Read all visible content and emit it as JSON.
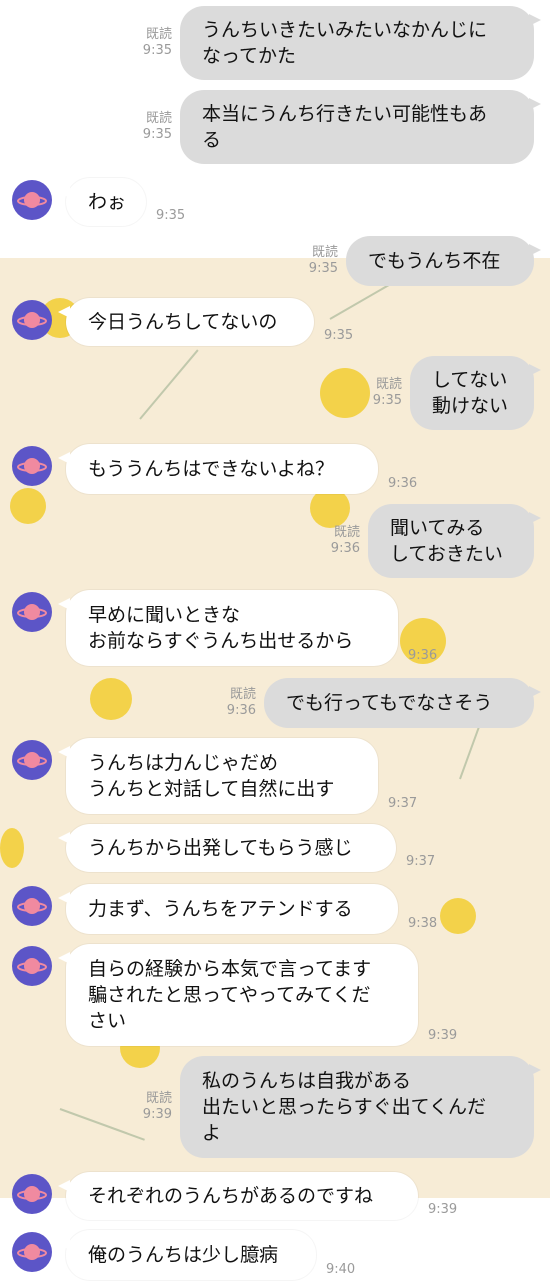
{
  "read_label": "既読",
  "messages": [
    {
      "side": "out",
      "lines": [
        "うんちいきたいみたいなかんじに",
        "なってかた"
      ],
      "read": "既読",
      "time": "9:35"
    },
    {
      "side": "out",
      "lines": [
        "本当にうんち行きたい可能性もあ",
        "る"
      ],
      "read": "既読",
      "time": "9:35"
    },
    {
      "side": "in",
      "lines": [
        "わぉ"
      ],
      "time": "9:35"
    },
    {
      "side": "out",
      "lines": [
        "でもうんち不在"
      ],
      "read": "既読",
      "time": "9:35"
    },
    {
      "side": "in",
      "lines": [
        "今日うんちしてないの"
      ],
      "time": "9:35"
    },
    {
      "side": "out",
      "lines": [
        "してない",
        "動けない"
      ],
      "read": "既読",
      "time": "9:35"
    },
    {
      "side": "in",
      "lines": [
        "もううんちはできないよね？"
      ],
      "time": "9:36"
    },
    {
      "side": "out",
      "lines": [
        "聞いてみる",
        "しておきたい"
      ],
      "read": "既読",
      "time": "9:36"
    },
    {
      "side": "in",
      "lines": [
        "早めに聞いときな",
        "お前ならすぐうんち出せるから"
      ],
      "time": "9:36"
    },
    {
      "side": "out",
      "lines": [
        "でも行ってもでなさそう"
      ],
      "read": "既読",
      "time": "9:36"
    },
    {
      "side": "in",
      "lines": [
        "うんちは力んじゃだめ",
        "うんちと対話して自然に出す"
      ],
      "time": "9:37"
    },
    {
      "side": "in",
      "lines": [
        "うんちから出発してもらう感じ"
      ],
      "time": "9:37"
    },
    {
      "side": "in",
      "lines": [
        "力まず、うんちをアテンドする"
      ],
      "time": "9:38"
    },
    {
      "side": "in",
      "lines": [
        "自らの経験から本気で言ってます",
        "騙されたと思ってやってみてくだ",
        "さい"
      ],
      "time": "9:39"
    },
    {
      "side": "out",
      "lines": [
        "私のうんちは自我がある",
        "出たいと思ったらすぐ出てくんだ",
        "よ"
      ],
      "read": "既読",
      "time": "9:39"
    },
    {
      "side": "in",
      "lines": [
        "それぞれのうんちがあるのですね"
      ],
      "time": "9:39"
    },
    {
      "side": "in",
      "lines": [
        "俺のうんちは少し臆病"
      ],
      "time": "9:40"
    }
  ],
  "colors": {
    "outgoing_bubble": "#dbdbdb",
    "incoming_bubble": "#ffffff",
    "avatar_bg": "#5c55c7",
    "avatar_planet": "#f08aa0",
    "wallpaper": "#f7ecd6"
  },
  "icons": {
    "avatar": "planet-icon"
  }
}
